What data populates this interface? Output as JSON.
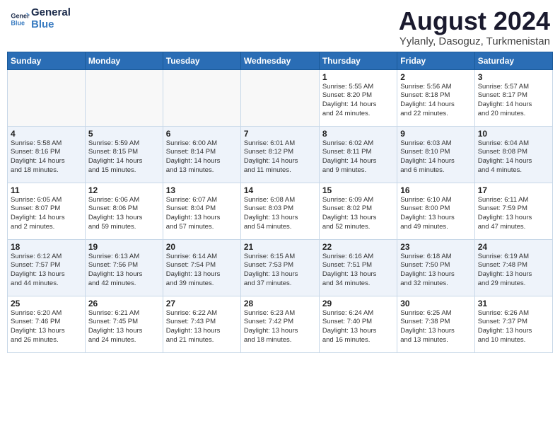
{
  "header": {
    "logo_line1": "General",
    "logo_line2": "Blue",
    "month_title": "August 2024",
    "subtitle": "Yylanly, Dasoguz, Turkmenistan"
  },
  "weekdays": [
    "Sunday",
    "Monday",
    "Tuesday",
    "Wednesday",
    "Thursday",
    "Friday",
    "Saturday"
  ],
  "weeks": [
    {
      "days": [
        {
          "number": "",
          "info": ""
        },
        {
          "number": "",
          "info": ""
        },
        {
          "number": "",
          "info": ""
        },
        {
          "number": "",
          "info": ""
        },
        {
          "number": "1",
          "info": "Sunrise: 5:55 AM\nSunset: 8:20 PM\nDaylight: 14 hours\nand 24 minutes."
        },
        {
          "number": "2",
          "info": "Sunrise: 5:56 AM\nSunset: 8:18 PM\nDaylight: 14 hours\nand 22 minutes."
        },
        {
          "number": "3",
          "info": "Sunrise: 5:57 AM\nSunset: 8:17 PM\nDaylight: 14 hours\nand 20 minutes."
        }
      ]
    },
    {
      "days": [
        {
          "number": "4",
          "info": "Sunrise: 5:58 AM\nSunset: 8:16 PM\nDaylight: 14 hours\nand 18 minutes."
        },
        {
          "number": "5",
          "info": "Sunrise: 5:59 AM\nSunset: 8:15 PM\nDaylight: 14 hours\nand 15 minutes."
        },
        {
          "number": "6",
          "info": "Sunrise: 6:00 AM\nSunset: 8:14 PM\nDaylight: 14 hours\nand 13 minutes."
        },
        {
          "number": "7",
          "info": "Sunrise: 6:01 AM\nSunset: 8:12 PM\nDaylight: 14 hours\nand 11 minutes."
        },
        {
          "number": "8",
          "info": "Sunrise: 6:02 AM\nSunset: 8:11 PM\nDaylight: 14 hours\nand 9 minutes."
        },
        {
          "number": "9",
          "info": "Sunrise: 6:03 AM\nSunset: 8:10 PM\nDaylight: 14 hours\nand 6 minutes."
        },
        {
          "number": "10",
          "info": "Sunrise: 6:04 AM\nSunset: 8:08 PM\nDaylight: 14 hours\nand 4 minutes."
        }
      ]
    },
    {
      "days": [
        {
          "number": "11",
          "info": "Sunrise: 6:05 AM\nSunset: 8:07 PM\nDaylight: 14 hours\nand 2 minutes."
        },
        {
          "number": "12",
          "info": "Sunrise: 6:06 AM\nSunset: 8:06 PM\nDaylight: 13 hours\nand 59 minutes."
        },
        {
          "number": "13",
          "info": "Sunrise: 6:07 AM\nSunset: 8:04 PM\nDaylight: 13 hours\nand 57 minutes."
        },
        {
          "number": "14",
          "info": "Sunrise: 6:08 AM\nSunset: 8:03 PM\nDaylight: 13 hours\nand 54 minutes."
        },
        {
          "number": "15",
          "info": "Sunrise: 6:09 AM\nSunset: 8:02 PM\nDaylight: 13 hours\nand 52 minutes."
        },
        {
          "number": "16",
          "info": "Sunrise: 6:10 AM\nSunset: 8:00 PM\nDaylight: 13 hours\nand 49 minutes."
        },
        {
          "number": "17",
          "info": "Sunrise: 6:11 AM\nSunset: 7:59 PM\nDaylight: 13 hours\nand 47 minutes."
        }
      ]
    },
    {
      "days": [
        {
          "number": "18",
          "info": "Sunrise: 6:12 AM\nSunset: 7:57 PM\nDaylight: 13 hours\nand 44 minutes."
        },
        {
          "number": "19",
          "info": "Sunrise: 6:13 AM\nSunset: 7:56 PM\nDaylight: 13 hours\nand 42 minutes."
        },
        {
          "number": "20",
          "info": "Sunrise: 6:14 AM\nSunset: 7:54 PM\nDaylight: 13 hours\nand 39 minutes."
        },
        {
          "number": "21",
          "info": "Sunrise: 6:15 AM\nSunset: 7:53 PM\nDaylight: 13 hours\nand 37 minutes."
        },
        {
          "number": "22",
          "info": "Sunrise: 6:16 AM\nSunset: 7:51 PM\nDaylight: 13 hours\nand 34 minutes."
        },
        {
          "number": "23",
          "info": "Sunrise: 6:18 AM\nSunset: 7:50 PM\nDaylight: 13 hours\nand 32 minutes."
        },
        {
          "number": "24",
          "info": "Sunrise: 6:19 AM\nSunset: 7:48 PM\nDaylight: 13 hours\nand 29 minutes."
        }
      ]
    },
    {
      "days": [
        {
          "number": "25",
          "info": "Sunrise: 6:20 AM\nSunset: 7:46 PM\nDaylight: 13 hours\nand 26 minutes."
        },
        {
          "number": "26",
          "info": "Sunrise: 6:21 AM\nSunset: 7:45 PM\nDaylight: 13 hours\nand 24 minutes."
        },
        {
          "number": "27",
          "info": "Sunrise: 6:22 AM\nSunset: 7:43 PM\nDaylight: 13 hours\nand 21 minutes."
        },
        {
          "number": "28",
          "info": "Sunrise: 6:23 AM\nSunset: 7:42 PM\nDaylight: 13 hours\nand 18 minutes."
        },
        {
          "number": "29",
          "info": "Sunrise: 6:24 AM\nSunset: 7:40 PM\nDaylight: 13 hours\nand 16 minutes."
        },
        {
          "number": "30",
          "info": "Sunrise: 6:25 AM\nSunset: 7:38 PM\nDaylight: 13 hours\nand 13 minutes."
        },
        {
          "number": "31",
          "info": "Sunrise: 6:26 AM\nSunset: 7:37 PM\nDaylight: 13 hours\nand 10 minutes."
        }
      ]
    }
  ]
}
